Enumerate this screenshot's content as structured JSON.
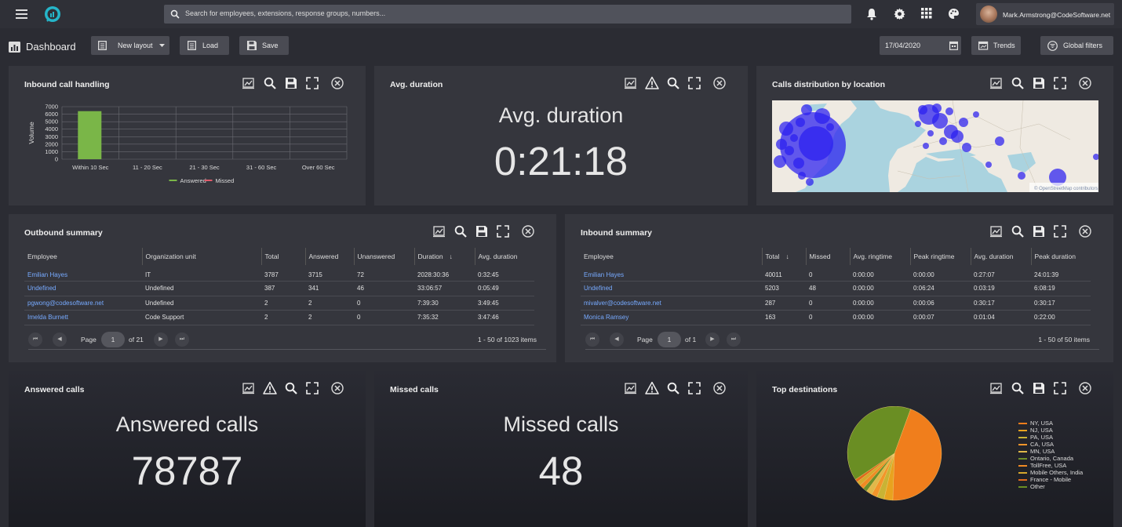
{
  "topbar": {
    "search_placeholder": "Search for employees, extensions, response groups, numbers...",
    "user_email": "Mark.Armstrong@CodeSoftware.net"
  },
  "toolbar": {
    "page_title": "Dashboard",
    "new_layout": "New layout",
    "load": "Load",
    "save": "Save",
    "date": "17/04/2020",
    "trends": "Trends",
    "global_filters": "Global filters"
  },
  "inbound_call_handling": {
    "title": "Inbound call handling",
    "chart_data": {
      "type": "bar",
      "categories": [
        "Within 10 Sec",
        "11 - 20 Sec",
        "21 - 30 Sec",
        "31 - 60 Sec",
        "Over 60 Sec"
      ],
      "series": [
        {
          "name": "Answered",
          "values": [
            6400,
            0,
            0,
            0,
            0
          ],
          "color": "#7ab648"
        },
        {
          "name": "Missed",
          "values": [
            0,
            0,
            0,
            0,
            0
          ],
          "color": "#e05a6a"
        }
      ],
      "ylabel": "Volume",
      "yticks": [
        "7000",
        "6000",
        "5000",
        "4000",
        "3000",
        "2000",
        "1000",
        "0"
      ],
      "ylim": [
        0,
        7000
      ],
      "grid": true,
      "legend": "bottom"
    }
  },
  "avg_duration": {
    "title": "Avg. duration",
    "heading": "Avg. duration",
    "value": "0:21:18"
  },
  "calls_distribution": {
    "title": "Calls distribution by location",
    "attribution": "© OpenStreetMap contributors"
  },
  "outbound_summary": {
    "title": "Outbound summary",
    "columns": [
      "Employee",
      "Organization unit",
      "Total",
      "Answered",
      "Unanswered",
      "Duration",
      "Avg. duration"
    ],
    "rows": [
      [
        "Emilian Hayes",
        "IT",
        "3787",
        "3715",
        "72",
        "2028:30:36",
        "0:32:45"
      ],
      [
        "Undefined",
        "Undefined",
        "387",
        "341",
        "46",
        "33:06:57",
        "0:05:49"
      ],
      [
        "pgwong@codesoftware.net",
        "Undefined",
        "2",
        "2",
        "0",
        "7:39:30",
        "3:49:45"
      ],
      [
        "Imelda Burnett",
        "Code Support",
        "2",
        "2",
        "0",
        "7:35:32",
        "3:47:46"
      ]
    ],
    "pager": {
      "page_label": "Page",
      "page": "1",
      "of": "of 21",
      "summary": "1 - 50 of 1023 items"
    }
  },
  "inbound_summary": {
    "title": "Inbound summary",
    "columns": [
      "Employee",
      "Total",
      "Missed",
      "Avg. ringtime",
      "Peak ringtime",
      "Avg. duration",
      "Peak duration"
    ],
    "rows": [
      [
        "Emilian Hayes",
        "40011",
        "0",
        "0:00:00",
        "0:00:00",
        "0:27:07",
        "24:01:39"
      ],
      [
        "Undefined",
        "5203",
        "48",
        "0:00:00",
        "0:06:24",
        "0:03:19",
        "6:08:19"
      ],
      [
        "mivalver@codesoftware.net",
        "287",
        "0",
        "0:00:00",
        "0:00:06",
        "0:30:17",
        "0:30:17"
      ],
      [
        "Monica Ramsey",
        "163",
        "0",
        "0:00:00",
        "0:00:07",
        "0:01:04",
        "0:22:00"
      ]
    ],
    "pager": {
      "page_label": "Page",
      "page": "1",
      "of": "of 1",
      "summary": "1 - 50 of 50 items"
    }
  },
  "answered_calls": {
    "title": "Answered calls",
    "heading": "Answered calls",
    "value": "78787"
  },
  "missed_calls": {
    "title": "Missed calls",
    "heading": "Missed calls",
    "value": "48"
  },
  "top_destinations": {
    "title": "Top destinations",
    "chart_data": {
      "type": "pie",
      "labels": [
        "NY, USA",
        "NJ, USA",
        "PA, USA",
        "CA, USA",
        "MN, USA",
        "Ontario, Canada",
        "TollFree, USA",
        "Mobile Others, India",
        "France - Mobile",
        "Other"
      ],
      "values": [
        45,
        3,
        2.5,
        2,
        2,
        1.5,
        1.5,
        1.5,
        1,
        40
      ],
      "colors": [
        "#f07e1c",
        "#e8a21f",
        "#c9b334",
        "#f3952a",
        "#e0b84a",
        "#6f8f2a",
        "#f08a24",
        "#d6a72c",
        "#e06a1c",
        "#6a8e23"
      ],
      "legend": "right"
    }
  }
}
